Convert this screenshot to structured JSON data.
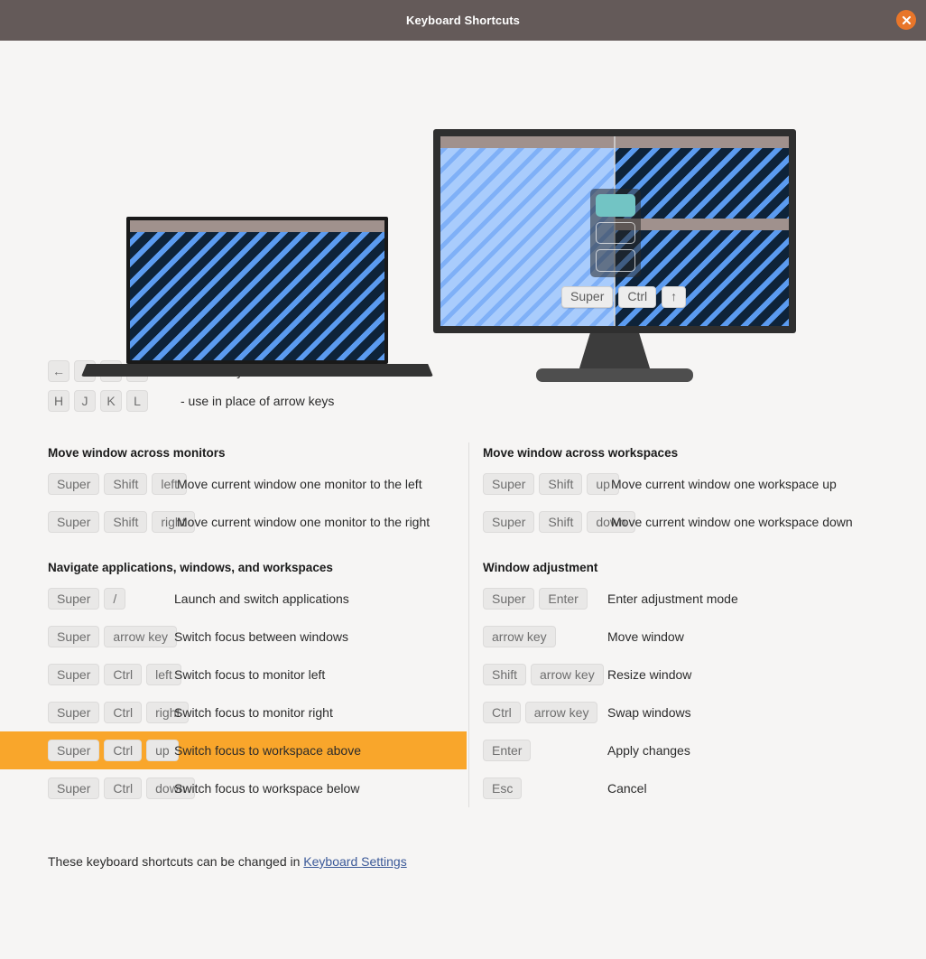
{
  "window": {
    "title": "Keyboard Shortcuts",
    "close_icon": "close-icon",
    "titlebar_color": "#645a59",
    "close_button_color": "#e8762a"
  },
  "illustration": {
    "monitor_overlay_keys": [
      "Super",
      "Ctrl",
      "↑"
    ],
    "workspace_switcher": {
      "items": 3,
      "active_index": 0,
      "active_color": "#72c4c4"
    }
  },
  "legend": [
    {
      "keys": [
        "←",
        "↓",
        "↑",
        "→"
      ],
      "note": "- arrow keys"
    },
    {
      "keys": [
        "H",
        "J",
        "K",
        "L"
      ],
      "note": "- use in place of arrow keys"
    }
  ],
  "groups": {
    "move_monitors": {
      "title": "Move window across monitors",
      "rows": [
        {
          "keys": [
            "Super",
            "Shift",
            "left"
          ],
          "desc": "Move current window one monitor to the left",
          "highlight": false
        },
        {
          "keys": [
            "Super",
            "Shift",
            "right"
          ],
          "desc": "Move current window one monitor to the right",
          "highlight": false
        }
      ]
    },
    "navigate": {
      "title": "Navigate applications, windows, and workspaces",
      "rows": [
        {
          "keys": [
            "Super",
            "/"
          ],
          "desc": "Launch and switch applications",
          "highlight": false
        },
        {
          "keys": [
            "Super",
            "arrow key"
          ],
          "desc": "Switch focus between windows",
          "highlight": false
        },
        {
          "keys": [
            "Super",
            "Ctrl",
            "left"
          ],
          "desc": "Switch focus to monitor left",
          "highlight": false
        },
        {
          "keys": [
            "Super",
            "Ctrl",
            "right"
          ],
          "desc": "Switch focus to monitor right",
          "highlight": false
        },
        {
          "keys": [
            "Super",
            "Ctrl",
            "up"
          ],
          "desc": "Switch focus to workspace above",
          "highlight": true
        },
        {
          "keys": [
            "Super",
            "Ctrl",
            "down"
          ],
          "desc": "Switch focus to workspace below",
          "highlight": false
        }
      ]
    },
    "move_workspaces": {
      "title": "Move window across workspaces",
      "rows": [
        {
          "keys": [
            "Super",
            "Shift",
            "up"
          ],
          "desc": "Move current window one workspace up",
          "highlight": false
        },
        {
          "keys": [
            "Super",
            "Shift",
            "down"
          ],
          "desc": "Move current window one workspace down",
          "highlight": false
        }
      ]
    },
    "window_adjustment": {
      "title": "Window adjustment",
      "rows": [
        {
          "keys": [
            "Super",
            "Enter"
          ],
          "desc": "Enter adjustment mode",
          "highlight": false
        },
        {
          "keys": [
            "arrow key"
          ],
          "desc": "Move window",
          "highlight": false
        },
        {
          "keys": [
            "Shift",
            "arrow key"
          ],
          "desc": "Resize window",
          "highlight": false
        },
        {
          "keys": [
            "Ctrl",
            "arrow key"
          ],
          "desc": "Swap windows",
          "highlight": false
        },
        {
          "keys": [
            "Enter"
          ],
          "desc": "Apply changes",
          "highlight": false
        },
        {
          "keys": [
            "Esc"
          ],
          "desc": "Cancel",
          "highlight": false
        }
      ]
    }
  },
  "footer": {
    "text": "These keyboard shortcuts can be changed in ",
    "link": "Keyboard Settings"
  },
  "colors": {
    "highlight_row": "#f9a62b",
    "link": "#3b5998",
    "key_bg": "#e9e8e7",
    "key_text": "#6e6e6e",
    "page_bg": "#f6f5f4"
  }
}
